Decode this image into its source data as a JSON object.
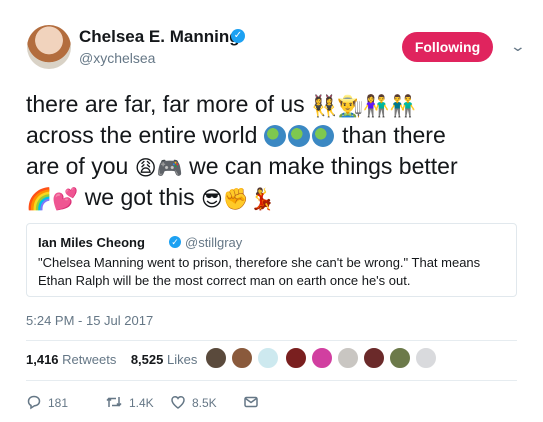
{
  "author": {
    "name": "Chelsea E. Manning",
    "handle": "@xychelsea",
    "verified_mark": "✓"
  },
  "follow_button": {
    "label": "Following",
    "color": "#e0245e"
  },
  "menu_chevron": "⌄",
  "tweet": {
    "line1_text": "there are far, far more of us",
    "line1_emoji": "👯‍♀️👨‍🌾👫👬",
    "line2_text": "across the entire world",
    "line2_tail": "than there",
    "line3_text": "are of you",
    "line3_emoji": "😩🎮",
    "line3_tail": "we can make things better",
    "line4_emoji": "🌈💕",
    "line4_text": "we got this",
    "line4_tail_emoji": "😎✊💃"
  },
  "quoted": {
    "name": "Ian Miles Cheong",
    "verified_mark": "✓",
    "handle": "@stillgray",
    "text": "\"Chelsea Manning went to prison, therefore she can't be wrong.\" That means Ethan Ralph will be the most correct man on earth once he's out."
  },
  "timestamp": "5:24 PM - 15 Jul 2017",
  "stats": {
    "retweets_count": "1,416",
    "retweets_label": "Retweets",
    "likes_count": "8,525",
    "likes_label": "Likes"
  },
  "actions": {
    "reply_count": "181",
    "retweet_count": "1.4K",
    "like_count": "8.5K"
  },
  "colors": {
    "accent": "#1da1f2",
    "muted": "#657786",
    "text": "#14171a"
  },
  "icons": [
    "verified-icon",
    "chevron-down-icon",
    "reply-icon",
    "retweet-icon",
    "heart-icon",
    "message-icon"
  ]
}
